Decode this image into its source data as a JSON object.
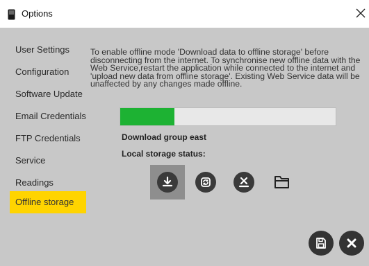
{
  "window": {
    "title": "Options"
  },
  "sidebar": {
    "items": [
      {
        "label": "User Settings"
      },
      {
        "label": "Configuration"
      },
      {
        "label": "Software Update"
      },
      {
        "label": "Email Credentials"
      },
      {
        "label": "FTP Credentials"
      },
      {
        "label": "Service"
      },
      {
        "label": "Readings"
      },
      {
        "label": "Offline storage",
        "active": true
      }
    ]
  },
  "main": {
    "info_text": "To enable offline mode 'Download data to offline storage' before disconnecting from the internet. To synchronise new offline data with the Web Service,restart the application while connected to the internet and 'upload new data from offline storage'. Existing Web Service data will be unaffected by any changes made offline.",
    "progress_fraction": 0.25,
    "download_group_label": "Download group east",
    "local_storage_label": "Local storage status:",
    "actions": [
      {
        "icon": "download-icon",
        "selected": true
      },
      {
        "icon": "sync-icon",
        "selected": false
      },
      {
        "icon": "clear-storage-icon",
        "selected": false
      },
      {
        "icon": "folder-icon",
        "selected": false
      }
    ]
  },
  "footer": {
    "save_icon": "save-icon",
    "cancel_icon": "close-icon"
  },
  "colors": {
    "background": "#c8c8c8",
    "active_item": "#ffd400",
    "progress_fill": "#1db233",
    "icon_dark": "#3a3a3a"
  }
}
